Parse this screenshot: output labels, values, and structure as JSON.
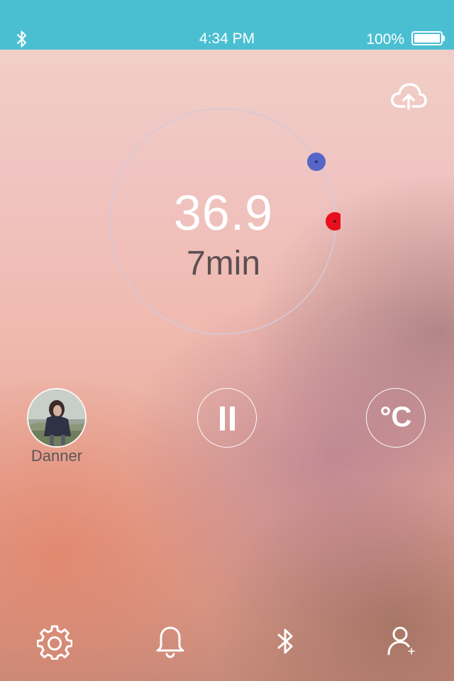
{
  "status_bar": {
    "time": "4:34 PM",
    "battery": "100%",
    "bluetooth_icon": "bluetooth-icon",
    "battery_icon": "battery-full-icon"
  },
  "header": {
    "upload_icon": "cloud-upload-icon"
  },
  "gauge": {
    "temperature": "36.9",
    "duration": "7min",
    "markers": [
      {
        "name": "blue-marker",
        "color": "#5566c8"
      },
      {
        "name": "red-marker",
        "color": "#e8101e"
      }
    ]
  },
  "controls": {
    "user_name": "Danner",
    "pause_icon": "pause-icon",
    "unit_label": "°C"
  },
  "toolbar": {
    "items": [
      {
        "name": "settings",
        "icon": "gear-icon"
      },
      {
        "name": "alarm",
        "icon": "bell-icon"
      },
      {
        "name": "bluetooth",
        "icon": "bluetooth-icon"
      },
      {
        "name": "add-user",
        "icon": "add-user-icon"
      }
    ]
  },
  "colors": {
    "status_bar": "#4bbfd2",
    "text_primary": "#ffffff",
    "text_secondary": "#5b4f51"
  }
}
